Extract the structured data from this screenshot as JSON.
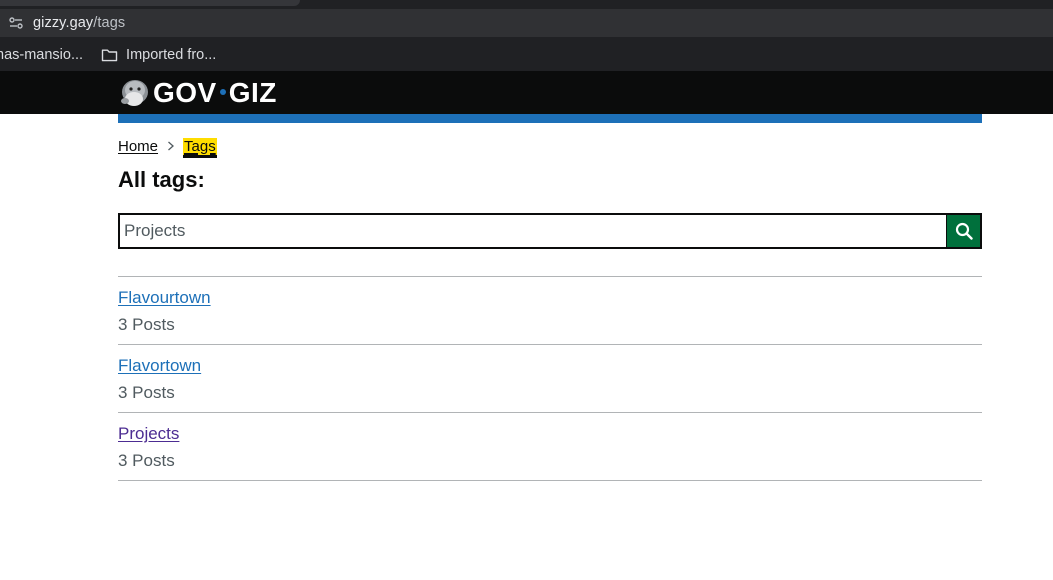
{
  "browser": {
    "url_host": "gizzy.gay",
    "url_path": "/tags",
    "bookmarks": [
      "nas-mansio...",
      "Imported fro..."
    ]
  },
  "site": {
    "logo_left": "GOV",
    "logo_right": "GIZ"
  },
  "breadcrumbs": {
    "home": "Home",
    "current": "Tags"
  },
  "page": {
    "title": "All tags:"
  },
  "search": {
    "placeholder": "Projects",
    "value": ""
  },
  "tags": [
    {
      "name": "Flavourtown",
      "count": "3 Posts",
      "visited": false
    },
    {
      "name": "Flavortown",
      "count": "3 Posts",
      "visited": false
    },
    {
      "name": "Projects",
      "count": "3 Posts",
      "visited": true
    }
  ],
  "colors": {
    "header_bg": "#0b0c0c",
    "accent_blue": "#1d70b8",
    "search_button": "#00703c",
    "highlight": "#ffdd00",
    "visited_link": "#4c2c92"
  }
}
